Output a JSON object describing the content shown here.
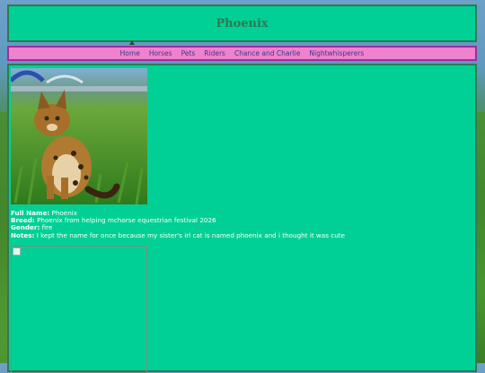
{
  "header": {
    "title": "Phoenix"
  },
  "nav": {
    "items": [
      {
        "label": "Home"
      },
      {
        "label": "Horses"
      },
      {
        "label": "Pets"
      },
      {
        "label": "Riders"
      },
      {
        "label": "Chance and Charlie"
      },
      {
        "label": "Nightwhisperers"
      }
    ]
  },
  "profile": {
    "full_name_label": "Full Name:",
    "full_name": "Phoenix",
    "breed_label": "Breed:",
    "breed": "Phoenix from helping mchorse equestrian festival 2026",
    "gender_label": "Gender:",
    "gender": "fire",
    "notes_label": "Notes:",
    "notes": "I kept the name for once because my sister's irl cat is named phoenix and i thought it was cute"
  },
  "colors": {
    "panel": "#00d095",
    "panel_border": "#2e7a52",
    "nav_bg": "#ee82cc",
    "nav_border": "#9b2fa0",
    "title_text": "#2c7a55"
  }
}
